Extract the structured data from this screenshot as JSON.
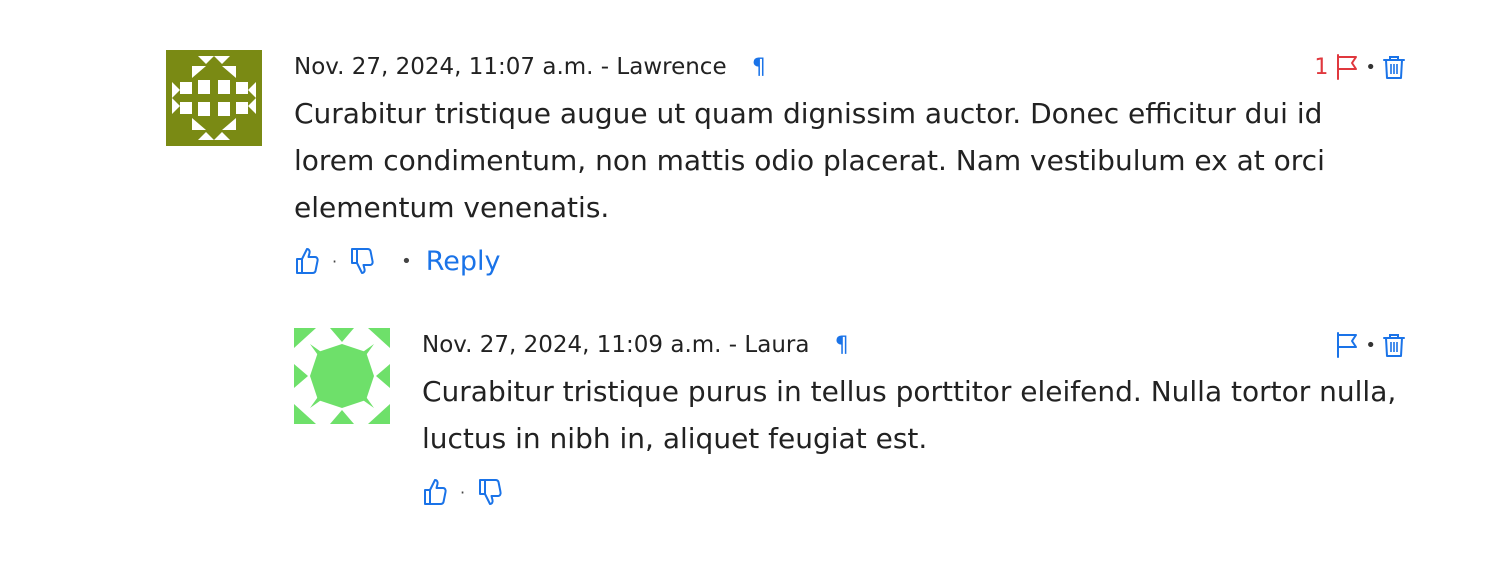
{
  "comments": [
    {
      "meta": "Nov. 27, 2024, 11:07 a.m. - Lawrence",
      "permalink_icon": "¶",
      "text": "Curabitur tristique augue ut quam dignissim auctor. Donec efficitur dui id lorem condimentum, non mattis odio placerat. Nam vestibulum ex at orci elementum venenatis.",
      "flag_count": "1",
      "flag_color": "#e0383e",
      "avatar_color": "#7a8a14",
      "reply_label": "Reply",
      "icons": [
        "thumbs-up-icon",
        "thumbs-down-icon",
        "flag-icon",
        "trash-icon",
        "pilcrow-icon"
      ]
    },
    {
      "meta": "Nov. 27, 2024, 11:09 a.m. - Laura",
      "permalink_icon": "¶",
      "text": "Curabitur tristique purus in tellus porttitor eleifend. Nulla tortor nulla, luctus in nibh in, aliquet feugiat est.",
      "flag_count": "",
      "flag_color": "#1a73e8",
      "avatar_color": "#6ee06a",
      "icons": [
        "thumbs-up-icon",
        "thumbs-down-icon",
        "flag-icon",
        "trash-icon",
        "pilcrow-icon"
      ]
    }
  ],
  "colors": {
    "accent": "#1a73e8",
    "flagged": "#e0383e",
    "text": "#222222"
  }
}
